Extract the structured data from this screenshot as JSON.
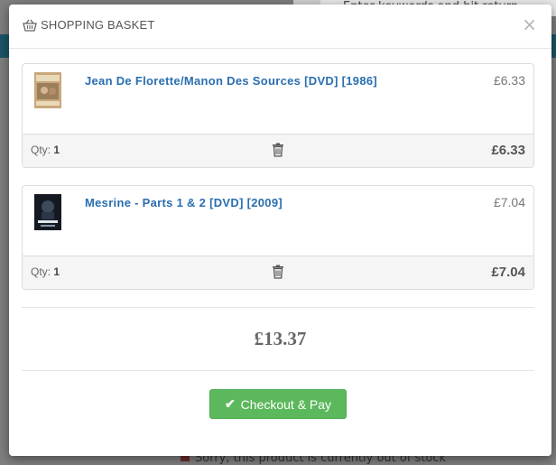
{
  "background": {
    "search_placeholder": "Enter keywords and hit return",
    "bottom_text": "Sorry, this product is currently out of stock"
  },
  "modal": {
    "title": "SHOPPING BASKET",
    "close_glyph": "×",
    "icon": "basket-icon"
  },
  "items": [
    {
      "title": "Jean De Florette/Manon Des Sources [DVD] [1986]",
      "unit_price": "£6.33",
      "qty_label": "Qty:",
      "qty": "1",
      "line_total": "£6.33"
    },
    {
      "title": "Mesrine - Parts 1 & 2 [DVD] [2009]",
      "unit_price": "£7.04",
      "qty_label": "Qty:",
      "qty": "1",
      "line_total": "£7.04"
    }
  ],
  "grand_total": "£13.37",
  "checkout_label": "Checkout & Pay",
  "colors": {
    "link": "#2a6eb0",
    "checkout_bg": "#5cb85c"
  }
}
